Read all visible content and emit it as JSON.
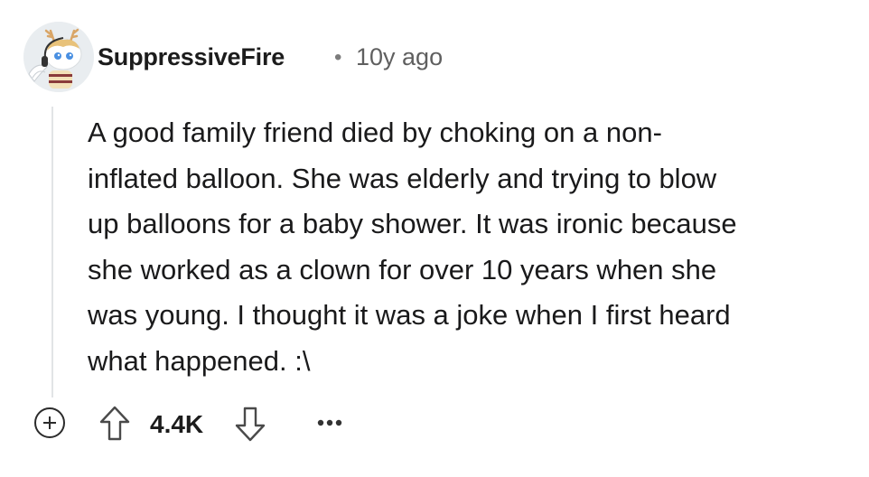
{
  "comment": {
    "username": "SuppressiveFire",
    "separator": "•",
    "timestamp": "10y ago",
    "body_lines": [
      "A good family friend died by choking on a non-",
      "inflated balloon. She was elderly and trying to blow",
      "up balloons for a baby shower. It was ironic because",
      "she worked as a clown for over 10 years when she",
      "was young. I thought it was a joke when I first heard",
      "what happened. :\\"
    ],
    "score": "4.4K"
  },
  "icons": {
    "expand": "plus-circle-icon",
    "upvote": "arrow-up-icon",
    "downvote": "arrow-down-icon",
    "more": "ellipsis-icon"
  }
}
